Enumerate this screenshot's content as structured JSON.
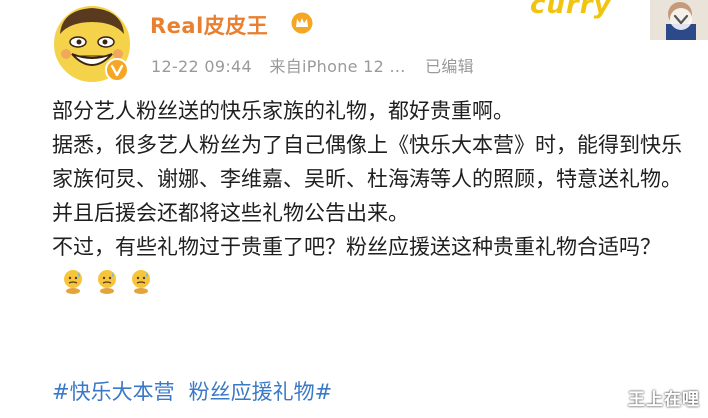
{
  "post": {
    "username": "Real皮皮王",
    "date": "12-22 09:44",
    "source": "来自iPhone 12 ...",
    "edited": "已编辑",
    "paragraphs": [
      "部分艺人粉丝送的快乐家族的礼物，都好贵重啊。",
      "据悉，很多艺人粉丝为了自己偶像上《快乐大本营》时，能得到快乐家族何炅、谢娜、李维嘉、吴昕、杜海涛等人的照顾，特意送礼物。并且后援会还都将这些礼物公告出来。",
      "不过，有些礼物过于贵重了吧？粉丝应援送这种贵重礼物合适吗？"
    ],
    "hashtags": [
      "#快乐大本营",
      "粉丝应援礼物#"
    ]
  },
  "banner": {
    "text": "curry"
  },
  "watermark": "王上在哩",
  "colors": {
    "username": "#e8802f",
    "meta": "#9a9a9a",
    "body_text": "#1f1f1f",
    "hashtag": "#3a78c8",
    "verified_badge": "#f5a623"
  },
  "icons": {
    "verified": "verified-v-icon",
    "crown": "crown-icon",
    "more": "chevron-down-icon",
    "emoji": "sweating-emoji-icon"
  }
}
